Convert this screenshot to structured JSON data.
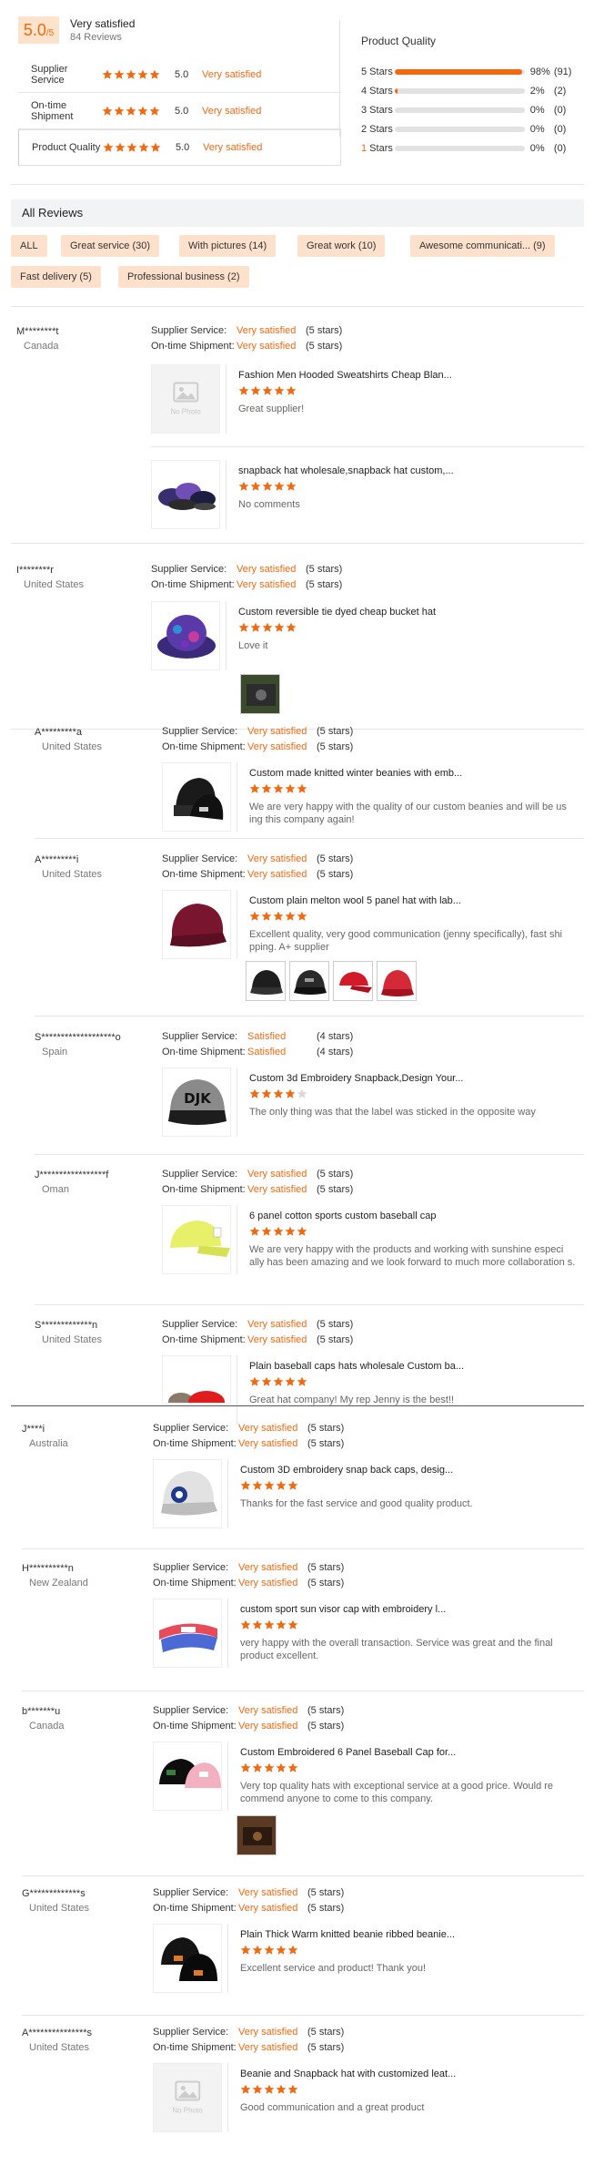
{
  "summary": {
    "score": "5.0",
    "score_of": "/5",
    "score_label": "Very satisfied",
    "review_count": "84 Reviews",
    "rows": [
      {
        "label": "Supplier Service",
        "value": "5.0",
        "text": "Very satisfied",
        "stars": 5
      },
      {
        "label": "On-time Shipment",
        "value": "5.0",
        "text": "Very satisfied",
        "stars": 5
      },
      {
        "label": "Product Quality",
        "value": "5.0",
        "text": "Very satisfied",
        "stars": 5
      }
    ]
  },
  "histogram": {
    "title": "Product Quality",
    "rows": [
      {
        "label": "5 Stars",
        "percent": 98,
        "pct_text": "98%",
        "count": "(91)"
      },
      {
        "label": "4 Stars",
        "percent": 2,
        "pct_text": "2%",
        "count": "(2)"
      },
      {
        "label": "3 Stars",
        "percent": 0,
        "pct_text": "0%",
        "count": "(0)"
      },
      {
        "label": "2 Stars",
        "percent": 0,
        "pct_text": "0%",
        "count": "(0)"
      },
      {
        "label": "1 Stars",
        "percent": 0,
        "pct_text": "0%",
        "count": "(0)"
      }
    ]
  },
  "all_reviews": {
    "title": "All Reviews",
    "tags": [
      "ALL",
      "Great service (30)",
      "With pictures (14)",
      "Great work (10)",
      "Awesome communicati... (9)",
      "Fast delivery (5)",
      "Professional business (2)"
    ]
  },
  "labels": {
    "supplier_service": "Supplier Service:",
    "on_time_shipment": "On-time Shipment:",
    "no_photo": "No Photo"
  },
  "colors": {
    "accent": "#f06a12",
    "tag_bg": "#fde1cc",
    "score_bg": "#fde3cc"
  },
  "reviews": [
    {
      "user": "M********t",
      "country": "Canada",
      "service": "Very satisfied",
      "service_stars": "(5 stars)",
      "shipment": "Very satisfied",
      "shipment_stars": "(5 stars)",
      "products": [
        {
          "title": "Fashion Men Hooded Sweatshirts Cheap Blan...",
          "stars": 5,
          "text": "Great supplier!",
          "image": "no-photo"
        },
        {
          "title": "snapback hat wholesale,snapback hat custom,...",
          "stars": 5,
          "text": "No comments",
          "image": "snapback-hats-photo"
        }
      ]
    },
    {
      "user": "I********r",
      "country": "United States",
      "service": "Very satisfied",
      "service_stars": "(5 stars)",
      "shipment": "Very satisfied",
      "shipment_stars": "(5 stars)",
      "products": [
        {
          "title": "Custom reversible tie dyed cheap bucket hat",
          "stars": 5,
          "text": "Love it",
          "image": "bucket-hat-photo"
        }
      ]
    },
    {
      "user": "A*********a",
      "country": "United States",
      "service": "Very satisfied",
      "service_stars": "(5 stars)",
      "shipment": "Very satisfied",
      "shipment_stars": "(5 stars)",
      "products": [
        {
          "title": "Custom made knitted winter beanies with emb...",
          "stars": 5,
          "text": "We are very happy with the quality of our custom beanies and will be us ing this company again!",
          "image": "beanies-photo"
        }
      ]
    },
    {
      "user": "A*********i",
      "country": "United States",
      "service": "Very satisfied",
      "service_stars": "(5 stars)",
      "shipment": "Very satisfied",
      "shipment_stars": "(5 stars)",
      "products": [
        {
          "title": "Custom plain melton wool 5 panel hat with lab...",
          "stars": 5,
          "text": "Excellent quality, very good communication (jenny specifically), fast shi pping. A+ supplier",
          "image": "melton-hat-photo"
        }
      ]
    },
    {
      "user": "S*******************o",
      "country": "Spain",
      "service": "Satisfied",
      "service_stars": "(4 stars)",
      "shipment": "Satisfied",
      "shipment_stars": "(4 stars)",
      "products": [
        {
          "title": "Custom 3d Embroidery Snapback,Design Your...",
          "stars": 4,
          "text": "The only thing was that the label was sticked in the opposite way",
          "image": "djk-snapback-photo"
        }
      ]
    },
    {
      "user": "J*****************f",
      "country": "Oman",
      "service": "Very satisfied",
      "service_stars": "(5 stars)",
      "shipment": "Very satisfied",
      "shipment_stars": "(5 stars)",
      "products": [
        {
          "title": "6 panel cotton sports custom baseball cap",
          "stars": 5,
          "text": "We are very happy with the products and working with sunshine especi ally has been amazing and we look forward to much more collaboration s.",
          "image": "yellow-cap-photo"
        }
      ]
    },
    {
      "user": "S*************n",
      "country": "United States",
      "service": "Very satisfied",
      "service_stars": "(5 stars)",
      "shipment": "Very satisfied",
      "shipment_stars": "(5 stars)",
      "products": [
        {
          "title": "Plain baseball caps hats wholesale Custom ba...",
          "stars": 5,
          "text": "Great hat company! My rep Jenny is the best!!",
          "image": "baseball-caps-photo"
        }
      ]
    },
    {
      "user": "J****i",
      "country": "Australia",
      "service": "Very satisfied",
      "service_stars": "(5 stars)",
      "shipment": "Very satisfied",
      "shipment_stars": "(5 stars)",
      "products": [
        {
          "title": "Custom 3D embroidery snap back caps, desig...",
          "stars": 5,
          "text": "Thanks for the fast service and good quality product.",
          "image": "snapback-grey-photo"
        }
      ]
    },
    {
      "user": "H**********n",
      "country": "New Zealand",
      "service": "Very satisfied",
      "service_stars": "(5 stars)",
      "shipment": "Very satisfied",
      "shipment_stars": "(5 stars)",
      "products": [
        {
          "title": "custom sport sun visor cap with embroidery l...",
          "stars": 5,
          "text": "very happy with the overall transaction. Service was great and the final product excellent.",
          "image": "visor-photo"
        }
      ]
    },
    {
      "user": "b*******u",
      "country": "Canada",
      "service": "Very satisfied",
      "service_stars": "(5 stars)",
      "shipment": "Very satisfied",
      "shipment_stars": "(5 stars)",
      "products": [
        {
          "title": "Custom Embroidered 6 Panel Baseball Cap for...",
          "stars": 5,
          "text": "Very top quality hats with exceptional service at a good price. Would re commend anyone to come to this company.",
          "image": "embroidered-caps-photo"
        }
      ]
    },
    {
      "user": "G*************s",
      "country": "United States",
      "service": "Very satisfied",
      "service_stars": "(5 stars)",
      "shipment": "Very satisfied",
      "shipment_stars": "(5 stars)",
      "products": [
        {
          "title": "Plain Thick Warm knitted beanie ribbed beanie...",
          "stars": 5,
          "text": "Excellent service and product! Thank you!",
          "image": "black-beanies-photo"
        }
      ]
    },
    {
      "user": "A***************s",
      "country": "United States",
      "service": "Very satisfied",
      "service_stars": "(5 stars)",
      "shipment": "Very satisfied",
      "shipment_stars": "(5 stars)",
      "products": [
        {
          "title": "Beanie and Snapback hat with customized leat...",
          "stars": 5,
          "text": "Good communication and a great product",
          "image": "no-photo"
        }
      ]
    }
  ]
}
